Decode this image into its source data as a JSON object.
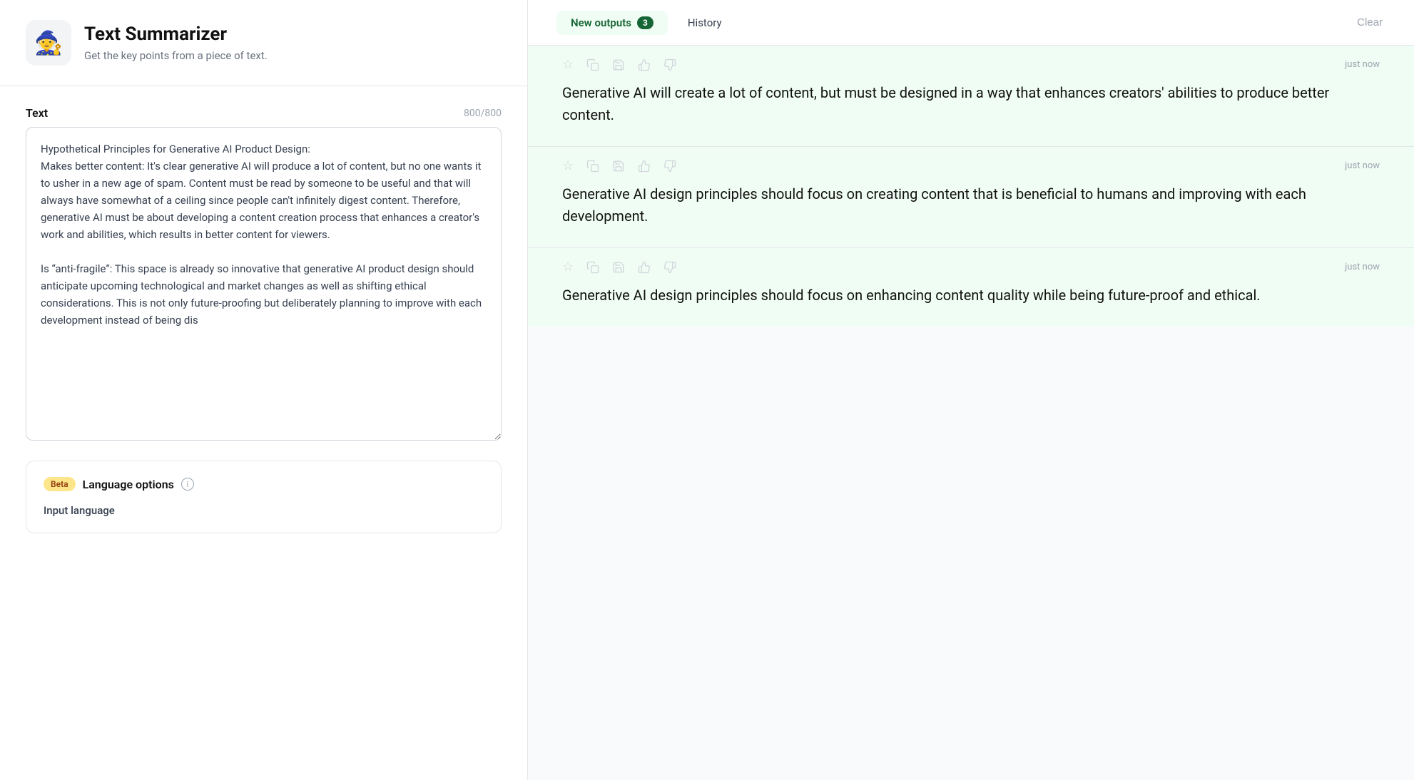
{
  "app": {
    "icon": "🧙",
    "title": "Text Summarizer",
    "subtitle": "Get the key points from a piece of text."
  },
  "left": {
    "text_label": "Text",
    "char_count": "800/800",
    "text_value": "Hypothetical Principles for Generative AI Product Design:\nMakes better content: It's clear generative AI will produce a lot of content, but no one wants it to usher in a new age of spam. Content must be read by someone to be useful and that will always have somewhat of a ceiling since people can't infinitely digest content. Therefore, generative AI must be about developing a content creation process that enhances a creator's work and abilities, which results in better content for viewers.\n\nIs “anti-fragile”: This space is already so innovative that generative AI product design should anticipate upcoming technological and market changes as well as shifting ethical considerations. This is not only future-proofing but deliberately planning to improve with each development instead of being dis",
    "options": {
      "beta_label": "Beta",
      "title": "Language options",
      "info_icon": "i",
      "input_language_label": "Input language"
    }
  },
  "right": {
    "tabs": {
      "new_outputs_label": "New outputs",
      "new_outputs_count": "3",
      "history_label": "History",
      "clear_label": "Clear"
    },
    "outputs": [
      {
        "timestamp": "just now",
        "text": "Generative AI will create a lot of content, but must be designed in a way that enhances creators' abilities to produce better content.",
        "actions": [
          "star",
          "copy",
          "save",
          "thumbs-up",
          "thumbs-down"
        ]
      },
      {
        "timestamp": "just now",
        "text": "Generative AI design principles should focus on creating content that is beneficial to humans and improving with each development.",
        "actions": [
          "star",
          "copy",
          "save",
          "thumbs-up",
          "thumbs-down"
        ]
      },
      {
        "timestamp": "just now",
        "text": "Generative AI design principles should focus on enhancing content quality while being future-proof and ethical.",
        "actions": [
          "star",
          "copy",
          "save",
          "thumbs-up",
          "thumbs-down"
        ]
      }
    ],
    "action_icons": {
      "star": "☆",
      "copy": "⧉",
      "save": "🖫",
      "thumbs_up": "👍",
      "thumbs_down": "👎"
    }
  }
}
